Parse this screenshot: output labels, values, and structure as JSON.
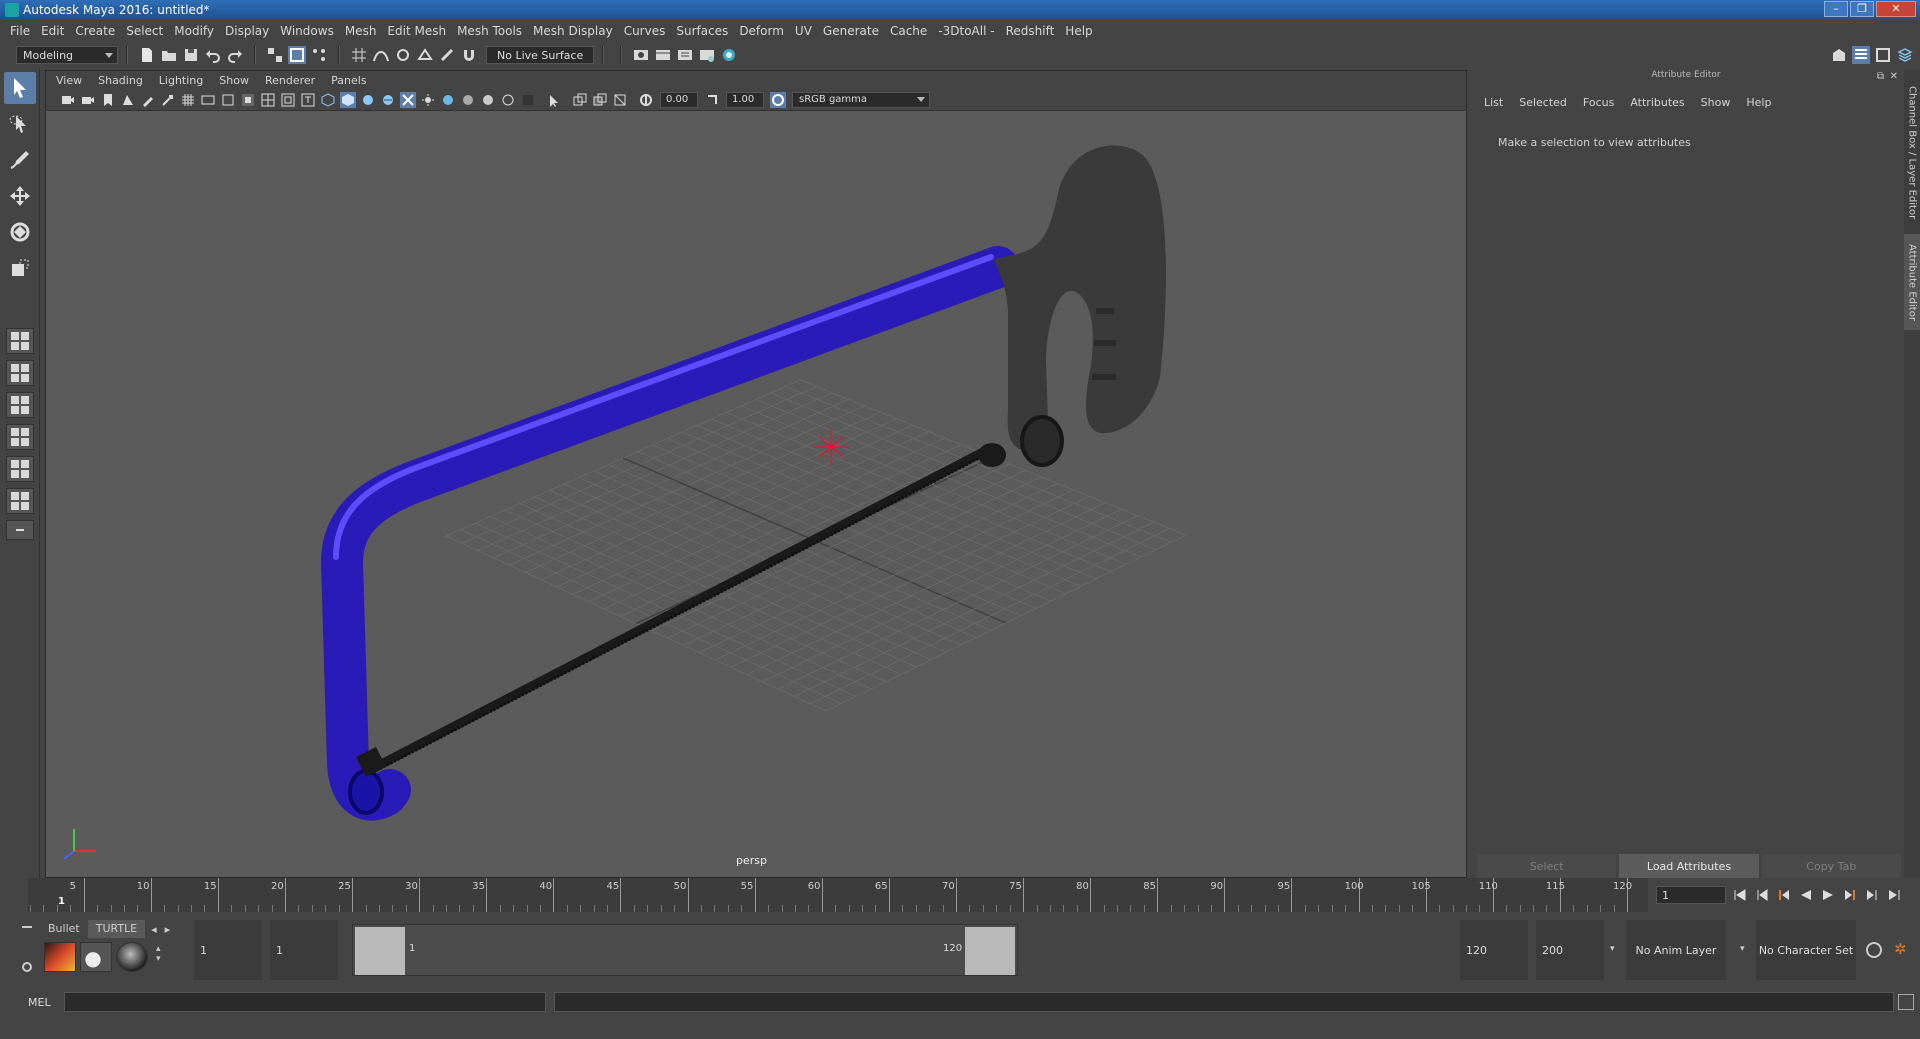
{
  "window": {
    "title": "Autodesk Maya 2016: untitled*",
    "controls": [
      "–",
      "❐",
      "✕"
    ]
  },
  "menus": [
    "File",
    "Edit",
    "Create",
    "Select",
    "Modify",
    "Display",
    "Windows",
    "Mesh",
    "Edit Mesh",
    "Mesh Tools",
    "Mesh Display",
    "Curves",
    "Surfaces",
    "Deform",
    "UV",
    "Generate",
    "Cache",
    "-3DtoAll -",
    "Redshift",
    "Help"
  ],
  "statusline": {
    "menuset": "Modeling",
    "live_surface": "No Live Surface"
  },
  "viewport": {
    "menus": [
      "View",
      "Shading",
      "Lighting",
      "Show",
      "Renderer",
      "Panels"
    ],
    "exposure": "0.00",
    "gamma": "1.00",
    "color_space": "sRGB gamma",
    "camera_label": "persp",
    "colors": {
      "frame": "#2a1ab8",
      "handle": "#3a3a3a",
      "blade": "#1a1a1a",
      "grid": "#6b6b6b",
      "origin": "#cc2233"
    }
  },
  "attribute_editor": {
    "header": "Attribute Editor",
    "menus": [
      "List",
      "Selected",
      "Focus",
      "Attributes",
      "Show",
      "Help"
    ],
    "message": "Make a selection to view attributes",
    "buttons": [
      "Select",
      "Load Attributes",
      "Copy Tab"
    ]
  },
  "side_tabs": [
    "Channel Box / Layer Editor",
    "Attribute Editor"
  ],
  "timeslider": {
    "labels": [
      "5",
      "10",
      "15",
      "20",
      "25",
      "30",
      "35",
      "40",
      "45",
      "50",
      "55",
      "60",
      "65",
      "70",
      "75",
      "80",
      "85",
      "90",
      "95",
      "100",
      "105",
      "110",
      "115",
      "120"
    ],
    "current_frame_marker": "1",
    "current_frame": "1"
  },
  "range": {
    "shelf_tabs": [
      "Bullet",
      "TURTLE"
    ],
    "start_time": "1",
    "playback_start": "1",
    "bar_start": "1",
    "bar_end": "120",
    "playback_end": "120",
    "end_time": "200",
    "anim_layer": "No Anim Layer",
    "character_set": "No Character Set"
  },
  "commandline": {
    "label": "MEL"
  }
}
